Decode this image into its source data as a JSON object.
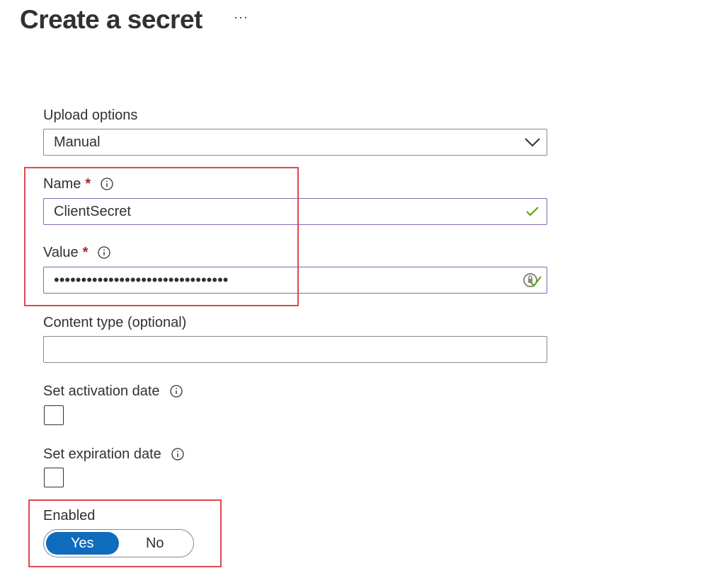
{
  "header": {
    "title": "Create a secret",
    "more_label": "···"
  },
  "form": {
    "upload_options": {
      "label": "Upload options",
      "value": "Manual"
    },
    "name": {
      "label": "Name",
      "required": "*",
      "value": "ClientSecret"
    },
    "value": {
      "label": "Value",
      "required": "*",
      "masked_value": "••••••••••••••••••••••••••••••••"
    },
    "content_type": {
      "label": "Content type (optional)",
      "value": ""
    },
    "activation_date": {
      "label": "Set activation date",
      "checked": false
    },
    "expiration_date": {
      "label": "Set expiration date",
      "checked": false
    },
    "enabled": {
      "label": "Enabled",
      "yes_label": "Yes",
      "no_label": "No",
      "selected": "Yes"
    }
  },
  "colors": {
    "accent": "#0f6cbd",
    "required": "#a4262c",
    "valid_check": "#57a300",
    "highlight": "#e0474f"
  }
}
